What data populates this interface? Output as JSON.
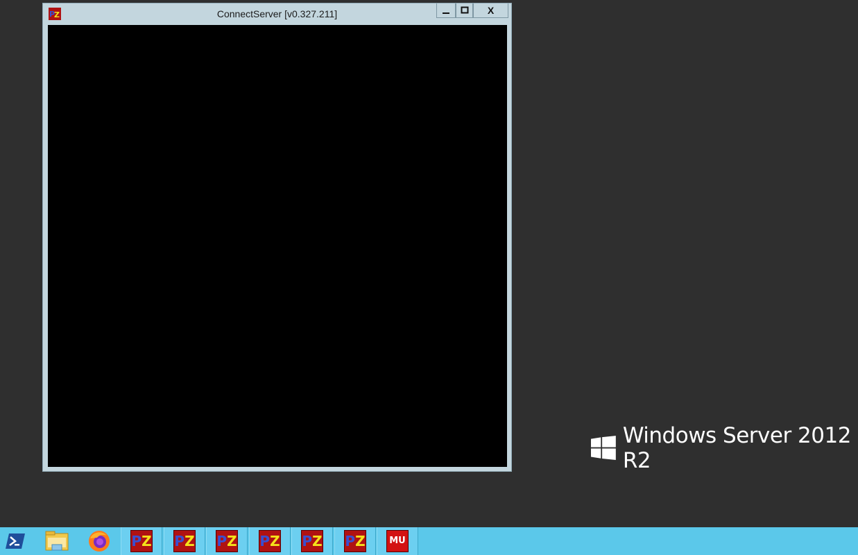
{
  "window": {
    "title": "ConnectServer [v0.327.211]",
    "icon": "pz-app-icon",
    "controls": {
      "minimize": "‒",
      "maximize": "□",
      "close": "X"
    }
  },
  "desktop": {
    "branding": "Windows Server 2012 R2"
  },
  "taskbar": {
    "color": "#5bc8ea",
    "items": [
      {
        "icon": "powershell-icon"
      },
      {
        "icon": "file-explorer-icon"
      },
      {
        "icon": "firefox-icon"
      },
      {
        "icon": "pz-app-icon",
        "label_p": "P",
        "label_z": "Z"
      },
      {
        "icon": "pz-app-icon",
        "label_p": "P",
        "label_z": "Z"
      },
      {
        "icon": "pz-app-icon",
        "label_p": "P",
        "label_z": "Z"
      },
      {
        "icon": "pz-app-icon",
        "label_p": "P",
        "label_z": "Z"
      },
      {
        "icon": "pz-app-icon",
        "label_p": "P",
        "label_z": "Z"
      },
      {
        "icon": "pz-app-icon",
        "label_p": "P",
        "label_z": "Z"
      },
      {
        "icon": "mu-app-icon",
        "label": "MU"
      }
    ]
  }
}
